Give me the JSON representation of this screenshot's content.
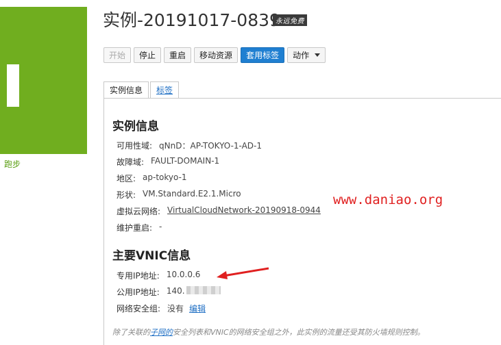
{
  "status": {
    "label": "跑步",
    "color": "#70ae1f"
  },
  "header": {
    "title": "实例-20191017-0839",
    "badge": "永远免费"
  },
  "toolbar": {
    "start": "开始",
    "stop": "停止",
    "restart": "重启",
    "move": "移动资源",
    "apply_tags": "套用标签",
    "actions": "动作"
  },
  "tabs": [
    {
      "label": "实例信息"
    },
    {
      "label": "标签"
    }
  ],
  "instance_info": {
    "title": "实例信息",
    "rows": [
      {
        "k": "可用性域:",
        "v": "qNnD：AP-TOKYO-1-AD-1"
      },
      {
        "k": "故障域:",
        "v": "FAULT-DOMAIN-1"
      },
      {
        "k": "地区:",
        "v": "ap-tokyo-1"
      },
      {
        "k": "形状:",
        "v": "VM.Standard.E2.1.Micro"
      },
      {
        "k": "虚拟云网络:",
        "v": "VirtualCloudNetwork-20190918-0944"
      },
      {
        "k": "维护重启:",
        "v": "-"
      }
    ]
  },
  "vnic": {
    "title": "主要VNIC信息",
    "private_ip_k": "专用IP地址:",
    "private_ip_v": "10.0.0.6",
    "public_ip_k": "公用IP地址:",
    "public_ip_v": "140.",
    "nsg_k": "网络安全组:",
    "nsg_v": "没有",
    "nsg_edit": "编辑"
  },
  "watermark": "www.daniao.org",
  "footnote": {
    "prefix": "除了关联的",
    "link": "子网的",
    "suffix": "安全列表和VNIC的网络安全组之外，此实例的流量还受其防火墙规则控制。"
  }
}
